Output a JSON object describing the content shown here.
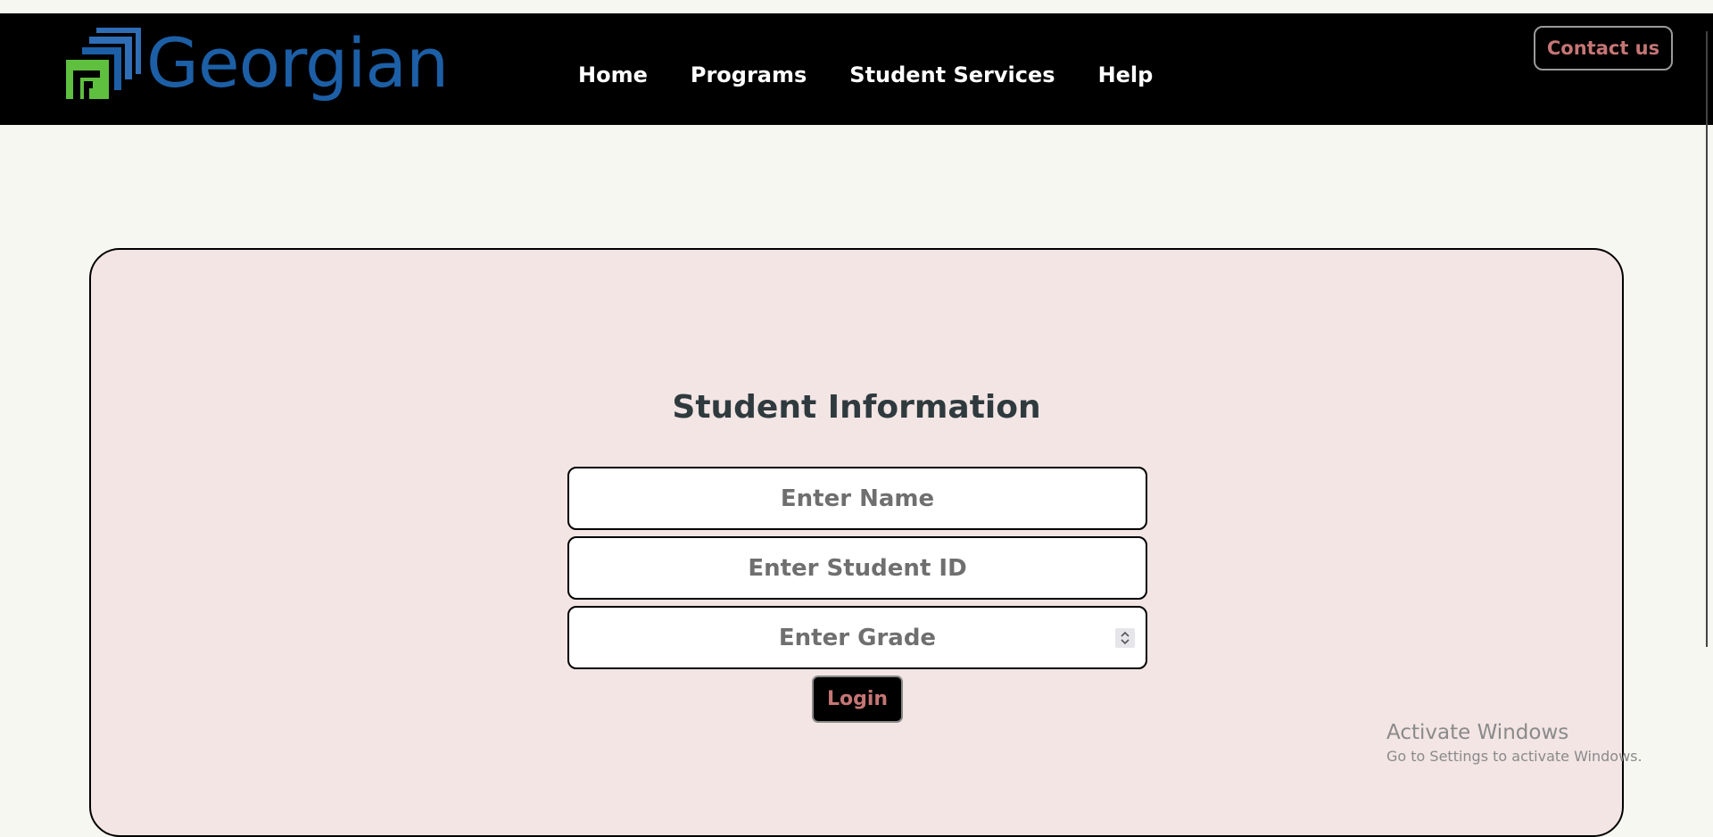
{
  "header": {
    "logo_text": "Georgian",
    "nav": [
      "Home",
      "Programs",
      "Student Services",
      "Help"
    ],
    "contact_label": "Contact us"
  },
  "form": {
    "title": "Student Information",
    "name_placeholder": "Enter Name",
    "id_placeholder": "Enter Student ID",
    "grade_placeholder": "Enter Grade",
    "login_label": "Login"
  },
  "watermark": {
    "line1": "Activate Windows",
    "line2": "Go to Settings to activate Windows."
  },
  "colors": {
    "background": "#f7f7f2",
    "navbar": "#000000",
    "logo_blue": "#1c5fa6",
    "logo_green": "#5fbf3f",
    "card": "#f2e5e4",
    "accent_text": "#c57575"
  },
  "icons": {
    "logo": "georgian-logo-mark-icon",
    "stepper": "number-stepper-icon"
  }
}
